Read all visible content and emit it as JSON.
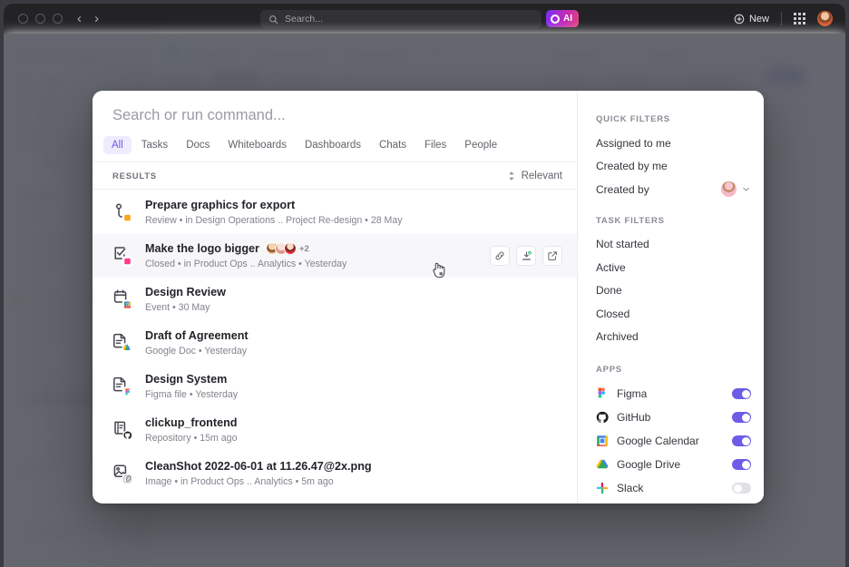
{
  "titlebar": {
    "search_placeholder": "Search...",
    "ai_label": "AI",
    "new_label": "New",
    "icons": {
      "search": "search-icon",
      "apps_grid": "apps-grid-icon",
      "avatar": "user-avatar"
    }
  },
  "palette": {
    "input_value": "",
    "input_placeholder": "Search or run command...",
    "tabs": [
      {
        "label": "All",
        "active": true
      },
      {
        "label": "Tasks",
        "active": false
      },
      {
        "label": "Docs",
        "active": false
      },
      {
        "label": "Whiteboards",
        "active": false
      },
      {
        "label": "Dashboards",
        "active": false
      },
      {
        "label": "Chats",
        "active": false
      },
      {
        "label": "Files",
        "active": false
      },
      {
        "label": "People",
        "active": false
      }
    ],
    "results_label": "RESULTS",
    "sort_label": "Relevant",
    "results": [
      {
        "title": "Prepare graphics for export",
        "icon": "task-subtask-icon",
        "status_color": "#faa61a",
        "meta": [
          "Review",
          "in Design Operations ..",
          "Project Re-design",
          "28 May"
        ],
        "meta_render": "Review  •  in Design Operations ..  Project Re-design  •  28 May",
        "selected": false,
        "avatars": [],
        "avatar_overflow": "",
        "actions": []
      },
      {
        "title": "Make the logo bigger",
        "icon": "task-checked-icon",
        "status_color": "#ff3c8e",
        "meta": [
          "Closed",
          "in Product Ops ..",
          "Analytics",
          "Yesterday"
        ],
        "meta_render": "Closed  •  in Product Ops ..  Analytics  •  Yesterday",
        "selected": true,
        "avatars": [
          "#e8b27e",
          "#f2c6c0",
          "#ef2b3c"
        ],
        "avatar_overflow": "+2",
        "actions": [
          "copy-link-icon",
          "merge-task-icon",
          "open-external-icon"
        ]
      },
      {
        "title": "Design Review",
        "icon": "calendar-event-icon",
        "badge": "google-calendar-icon",
        "meta": [
          "Event",
          "30 May"
        ],
        "meta_render": "Event  •  30 May",
        "selected": false,
        "avatars": [],
        "avatar_overflow": "",
        "actions": []
      },
      {
        "title": "Draft of Agreement",
        "icon": "document-icon",
        "badge": "google-drive-icon",
        "meta": [
          "Google Doc",
          "Yesterday"
        ],
        "meta_render": "Google Doc  •  Yesterday",
        "selected": false,
        "avatars": [],
        "avatar_overflow": "",
        "actions": []
      },
      {
        "title": "Design System",
        "icon": "document-icon",
        "badge": "figma-icon",
        "meta": [
          "Figma file",
          "Yesterday"
        ],
        "meta_render": "Figma file  •  Yesterday",
        "selected": false,
        "avatars": [],
        "avatar_overflow": "",
        "actions": []
      },
      {
        "title": "clickup_frontend",
        "icon": "repository-icon",
        "badge": "github-icon",
        "meta": [
          "Repository",
          "15m ago"
        ],
        "meta_render": "Repository  •  15m ago",
        "selected": false,
        "avatars": [],
        "avatar_overflow": "",
        "actions": []
      },
      {
        "title": "CleanShot 2022-06-01 at 11.26.47@2x.png",
        "icon": "image-file-icon",
        "badge": "attachment-icon",
        "meta": [
          "Image",
          "in Product Ops ..",
          "Analytics",
          "5m ago"
        ],
        "meta_render": "Image  •  in Product Ops ..  Analytics  •  5m ago",
        "selected": false,
        "avatars": [],
        "avatar_overflow": "",
        "actions": []
      }
    ]
  },
  "filters_panel": {
    "quick_filters_title": "QUICK FILTERS",
    "quick_filters": [
      {
        "label": "Assigned to me",
        "has_avatar": false
      },
      {
        "label": "Created by me",
        "has_avatar": false
      },
      {
        "label": "Created by",
        "has_avatar": true
      }
    ],
    "task_filters_title": "TASK FILTERS",
    "task_filters": [
      {
        "label": "Not started"
      },
      {
        "label": "Active"
      },
      {
        "label": "Done"
      },
      {
        "label": "Closed"
      },
      {
        "label": "Archived"
      }
    ],
    "apps_title": "APPS",
    "apps": [
      {
        "label": "Figma",
        "icon": "figma-icon",
        "enabled": true
      },
      {
        "label": "GitHub",
        "icon": "github-icon",
        "enabled": true
      },
      {
        "label": "Google Calendar",
        "icon": "google-calendar-icon",
        "enabled": true
      },
      {
        "label": "Google Drive",
        "icon": "google-drive-icon",
        "enabled": true
      },
      {
        "label": "Slack",
        "icon": "slack-icon",
        "enabled": false
      }
    ]
  },
  "colors": {
    "accent": "#6c5ce7",
    "accent_tab_bg": "#eeecfd",
    "overlay": "#53565e",
    "row_selected": "#f7f7fa",
    "titlebar": "#232326"
  }
}
